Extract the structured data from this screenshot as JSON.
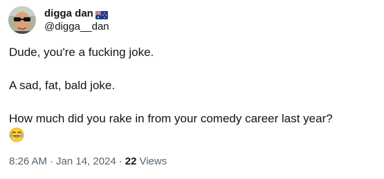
{
  "author": {
    "display_name": "digga dan",
    "handle": "@digga__dan",
    "flag_icon": "australia-flag-icon",
    "avatar_icon": "avatar-with-sunglasses"
  },
  "tweet": {
    "paragraphs": [
      "Dude, you're a fucking joke.",
      "A sad, fat, bald joke.",
      "How much did you rake in from your comedy career last year?"
    ],
    "trailing_emoji": "face-with-tears-of-joy-icon"
  },
  "meta": {
    "time": "8:26 AM",
    "separator": "·",
    "date": "Jan 14, 2024",
    "views_count": "22",
    "views_label": "Views"
  },
  "colors": {
    "text_primary": "#0f1419",
    "text_secondary": "#536471",
    "background": "#ffffff"
  }
}
